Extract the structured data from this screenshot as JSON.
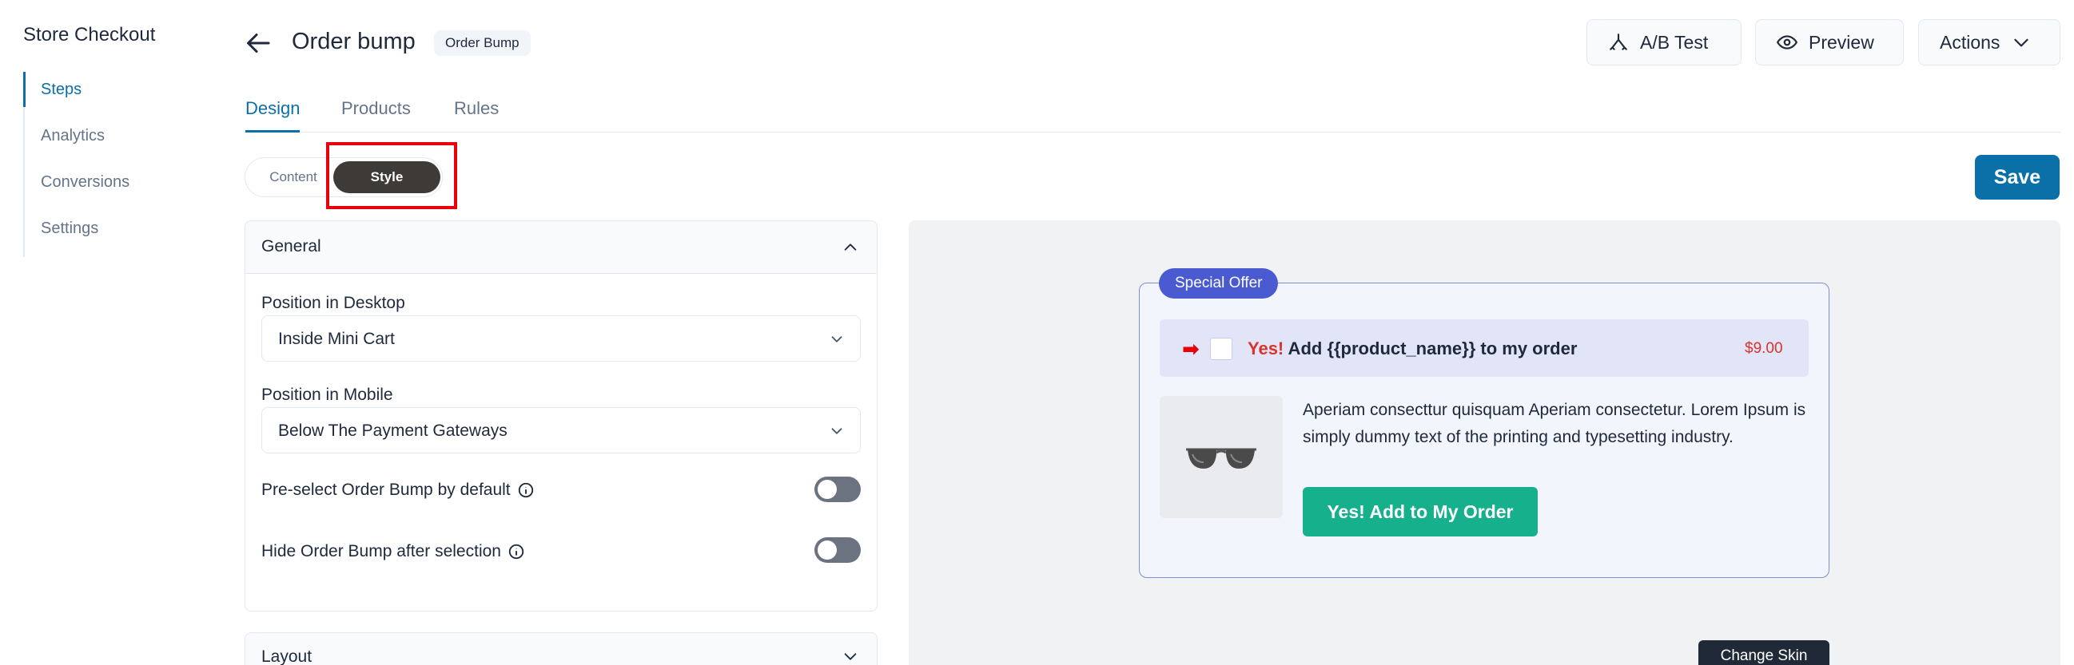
{
  "sidebar": {
    "app_title": "Store Checkout",
    "items": [
      {
        "label": "Steps",
        "active": true
      },
      {
        "label": "Analytics",
        "active": false
      },
      {
        "label": "Conversions",
        "active": false
      },
      {
        "label": "Settings",
        "active": false
      }
    ]
  },
  "header": {
    "title": "Order bump",
    "badge": "Order Bump",
    "ab_test_label": "A/B Test",
    "preview_label": "Preview",
    "actions_label": "Actions"
  },
  "tabs": [
    {
      "label": "Design",
      "active": true
    },
    {
      "label": "Products",
      "active": false
    },
    {
      "label": "Rules",
      "active": false
    }
  ],
  "segment": {
    "content_label": "Content",
    "style_label": "Style",
    "selected": "Style"
  },
  "save_label": "Save",
  "general_panel": {
    "title": "General",
    "position_desktop_label": "Position in Desktop",
    "position_desktop_value": "Inside Mini Cart",
    "position_mobile_label": "Position in Mobile",
    "position_mobile_value": "Below The Payment Gateways",
    "preselect_label": "Pre-select Order Bump by default",
    "preselect_on": false,
    "hide_label": "Hide Order Bump after selection",
    "hide_on": false
  },
  "layout_panel": {
    "title": "Layout"
  },
  "preview": {
    "badge": "Special Offer",
    "headline_yes": "Yes!",
    "headline_rest": " Add {{product_name}} to my order",
    "price": "$9.00",
    "description": "Aperiam consecttur quisquam Aperiam consectetur. Lorem Ipsum is simply dummy text of the printing and typesetting industry.",
    "button_label": "Yes! Add to My Order",
    "change_skin_label": "Change Skin"
  },
  "colors": {
    "primary": "#0b6fa8",
    "offer_badge": "#4a5bd1",
    "add_button": "#17b08d",
    "price": "#d9342b",
    "highlight": "#e8000b"
  }
}
